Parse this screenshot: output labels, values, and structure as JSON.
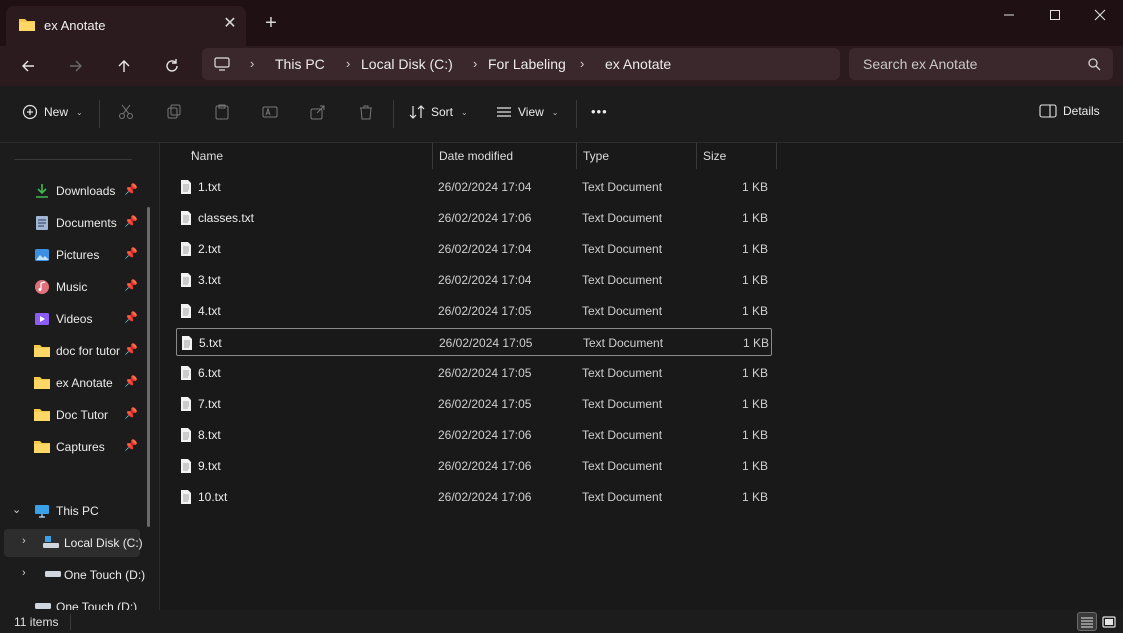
{
  "window": {
    "tab_title": "ex Anotate",
    "new_tab_label": "+"
  },
  "address": {
    "crumbs": [
      "This PC",
      "Local Disk (C:)",
      "For Labeling",
      "ex Anotate"
    ],
    "separator": ">"
  },
  "search": {
    "placeholder": "Search ex Anotate"
  },
  "toolbar": {
    "new_label": "New",
    "sort_label": "Sort",
    "view_label": "View",
    "more_label": "•••",
    "details_label": "Details"
  },
  "sidebar": {
    "quick_access": [
      {
        "label": "Downloads",
        "icon": "download-icon"
      },
      {
        "label": "Documents",
        "icon": "documents-icon"
      },
      {
        "label": "Pictures",
        "icon": "pictures-icon"
      },
      {
        "label": "Music",
        "icon": "music-icon"
      },
      {
        "label": "Videos",
        "icon": "videos-icon"
      },
      {
        "label": "doc for tutor",
        "icon": "folder-icon"
      },
      {
        "label": "ex Anotate",
        "icon": "folder-icon"
      },
      {
        "label": "Doc Tutor",
        "icon": "folder-icon"
      },
      {
        "label": "Captures",
        "icon": "folder-icon"
      }
    ],
    "this_pc": "This PC",
    "drives": [
      "Local Disk (C:)",
      "One Touch (D:)",
      "One Touch (D:)"
    ]
  },
  "columns": [
    "Name",
    "Date modified",
    "Type",
    "Size"
  ],
  "files": [
    {
      "name": "1.txt",
      "date": "26/02/2024 17:04",
      "type": "Text Document",
      "size": "1 KB"
    },
    {
      "name": "classes.txt",
      "date": "26/02/2024 17:06",
      "type": "Text Document",
      "size": "1 KB"
    },
    {
      "name": "2.txt",
      "date": "26/02/2024 17:04",
      "type": "Text Document",
      "size": "1 KB"
    },
    {
      "name": "3.txt",
      "date": "26/02/2024 17:04",
      "type": "Text Document",
      "size": "1 KB"
    },
    {
      "name": "4.txt",
      "date": "26/02/2024 17:05",
      "type": "Text Document",
      "size": "1 KB"
    },
    {
      "name": "5.txt",
      "date": "26/02/2024 17:05",
      "type": "Text Document",
      "size": "1 KB"
    },
    {
      "name": "6.txt",
      "date": "26/02/2024 17:05",
      "type": "Text Document",
      "size": "1 KB"
    },
    {
      "name": "7.txt",
      "date": "26/02/2024 17:05",
      "type": "Text Document",
      "size": "1 KB"
    },
    {
      "name": "8.txt",
      "date": "26/02/2024 17:06",
      "type": "Text Document",
      "size": "1 KB"
    },
    {
      "name": "9.txt",
      "date": "26/02/2024 17:06",
      "type": "Text Document",
      "size": "1 KB"
    },
    {
      "name": "10.txt",
      "date": "26/02/2024 17:06",
      "type": "Text Document",
      "size": "1 KB"
    }
  ],
  "status": {
    "item_count": "11 items"
  },
  "colors": {
    "titlebar": "#1f1013",
    "navbar": "#2b1b1f",
    "folder": "#f4c84a",
    "download": "#3fb950"
  }
}
